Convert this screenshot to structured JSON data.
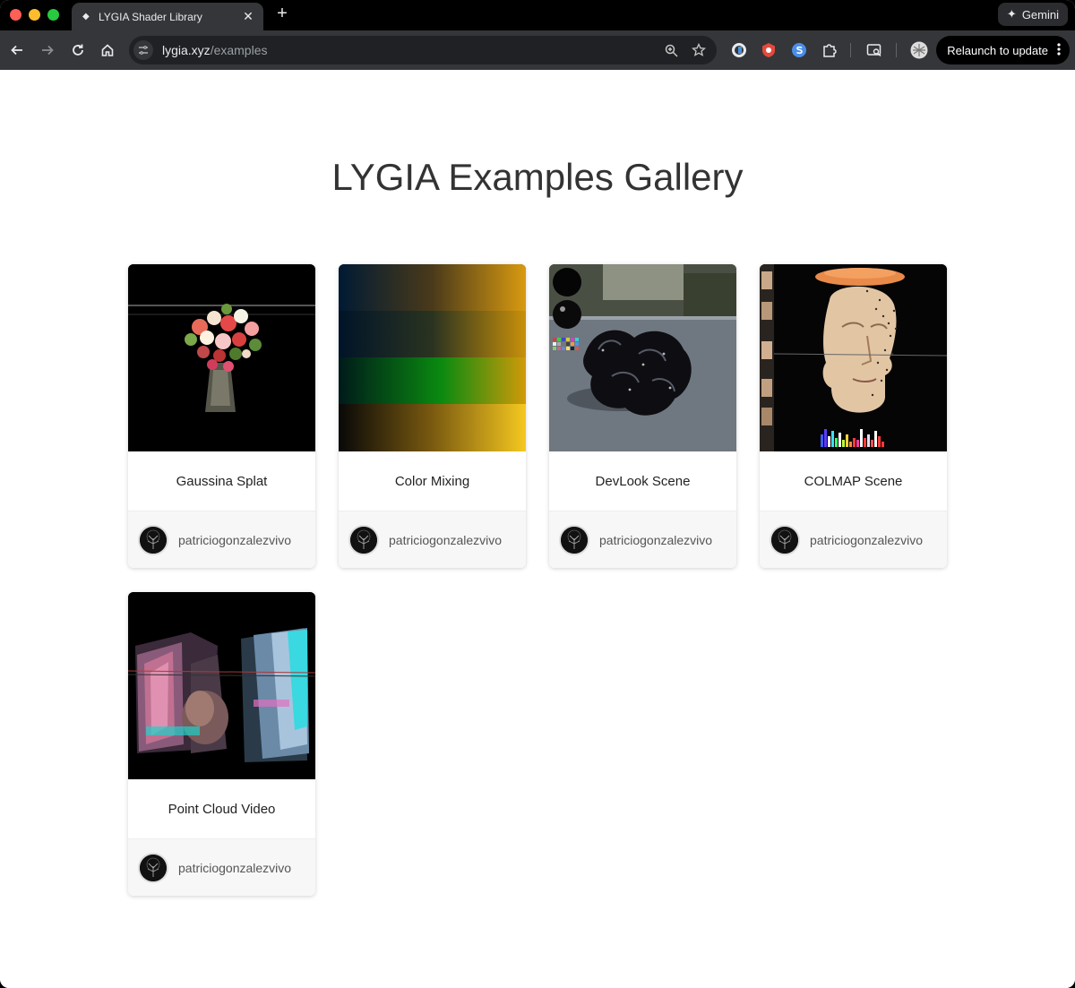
{
  "browser": {
    "tab": {
      "title": "LYGIA Shader Library",
      "icon": "lygia-favicon-icon",
      "close_icon": "close-icon"
    },
    "gemini_label": "Gemini",
    "url": {
      "host": "lygia.xyz",
      "path": "/examples"
    },
    "relaunch_label": "Relaunch to update"
  },
  "page": {
    "title": "LYGIA Examples Gallery",
    "examples": [
      {
        "title": "Gaussina Splat",
        "author": "patriciogonzalezvivo"
      },
      {
        "title": "Color Mixing",
        "author": "patriciogonzalezvivo"
      },
      {
        "title": "DevLook Scene",
        "author": "patriciogonzalezvivo"
      },
      {
        "title": "COLMAP Scene",
        "author": "patriciogonzalezvivo"
      },
      {
        "title": "Point Cloud Video",
        "author": "patriciogonzalezvivo"
      }
    ]
  },
  "colors": {
    "accent": "#35363a",
    "page_bg": "#ffffff",
    "title": "#333333"
  }
}
